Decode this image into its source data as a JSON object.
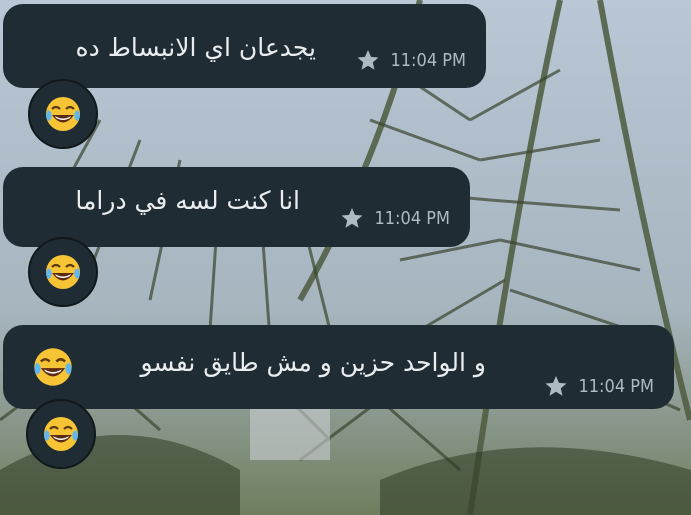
{
  "messages": [
    {
      "text": "يجدعان اي الانبساط ده",
      "time": "11:04 PM",
      "starred": true,
      "reaction": "face-with-tears-of-joy-icon"
    },
    {
      "text": "انا كنت لسه في دراما",
      "time": "11:04 PM",
      "starred": true,
      "reaction": "face-with-tears-of-joy-icon"
    },
    {
      "text": "و الواحد حزين و مش طايق نفسو",
      "time": "11:04 PM",
      "starred": true,
      "reaction": "face-with-tears-of-joy-icon",
      "inline_emoji": "face-with-tears-of-joy-icon"
    }
  ],
  "colors": {
    "bubble": "#202c33",
    "text": "#e9edef",
    "meta": "#aebac1"
  }
}
